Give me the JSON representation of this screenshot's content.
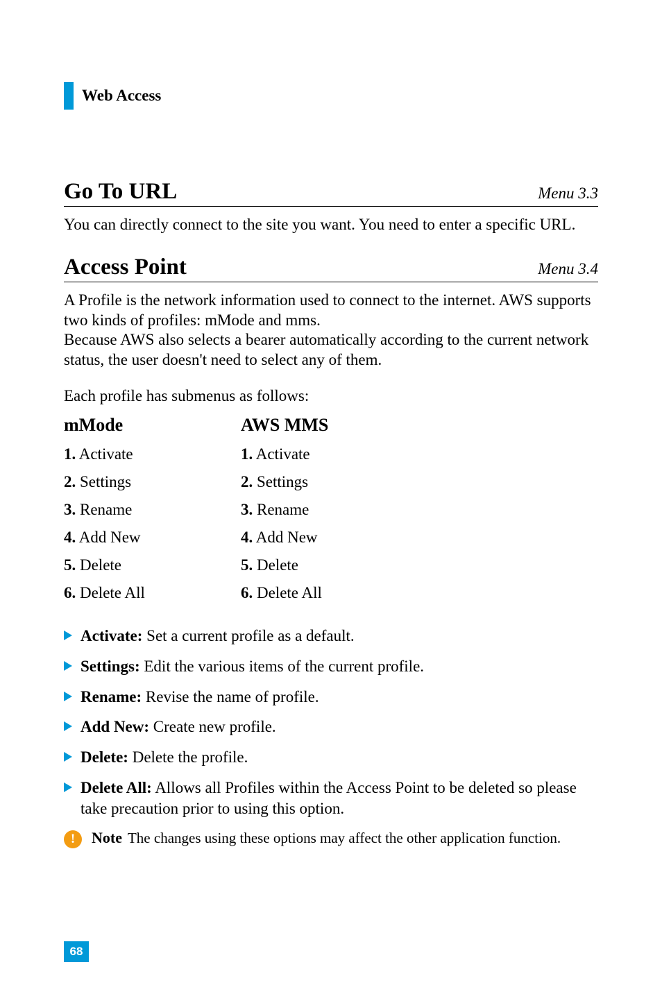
{
  "header": {
    "title": "Web Access"
  },
  "section1": {
    "title": "Go To URL",
    "menu": "Menu 3.3",
    "text": "You can directly connect to the site you want. You need to enter a specific URL."
  },
  "section2": {
    "title": "Access Point",
    "menu": "Menu 3.4",
    "para1": "A Profile is the network information used to connect to the internet. AWS supports two kinds of profiles: mMode and mms.",
    "para2": "Because AWS also selects a bearer automatically according to the current network status, the user doesn't need to select any of them.",
    "submenu_intro": "Each profile has submenus as follows:"
  },
  "columns": {
    "left": {
      "header": "mMode",
      "items": [
        {
          "num": "1.",
          "label": "Activate"
        },
        {
          "num": "2.",
          "label": "Settings"
        },
        {
          "num": "3.",
          "label": "Rename"
        },
        {
          "num": "4.",
          "label": "Add New"
        },
        {
          "num": "5.",
          "label": "Delete"
        },
        {
          "num": "6.",
          "label": "Delete All"
        }
      ]
    },
    "right": {
      "header": "AWS MMS",
      "items": [
        {
          "num": "1.",
          "label": "Activate"
        },
        {
          "num": "2.",
          "label": "Settings"
        },
        {
          "num": "3.",
          "label": "Rename"
        },
        {
          "num": "4.",
          "label": "Add New"
        },
        {
          "num": "5.",
          "label": "Delete"
        },
        {
          "num": "6.",
          "label": "Delete All"
        }
      ]
    }
  },
  "bullets": [
    {
      "bold": "Activate:",
      "text": " Set a current profile as a default."
    },
    {
      "bold": "Settings:",
      "text": " Edit the various items of the current profile."
    },
    {
      "bold": "Rename:",
      "text": " Revise the name of profile."
    },
    {
      "bold": "Add New:",
      "text": " Create new profile."
    },
    {
      "bold": "Delete:",
      "text": " Delete the profile."
    },
    {
      "bold": "Delete All:",
      "text": " Allows all Profiles within the Access Point to be deleted so please take precaution prior to using this option."
    }
  ],
  "note": {
    "icon": "!",
    "label": "Note",
    "text": "The changes using these options may affect the other application function."
  },
  "page_number": "68"
}
